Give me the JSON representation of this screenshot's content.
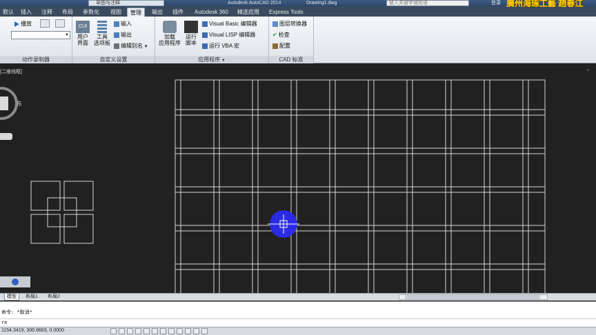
{
  "titlebar": {
    "workspace": "草图与注释",
    "app_title": "Autodesk AutoCAD 2014",
    "file_name": "Drawing1.dwg",
    "search_placeholder": "键入关键字或短语",
    "login": "登录",
    "watermark": "廣州海琢工藝 趙春江"
  },
  "ribbon_tabs": [
    "默认",
    "插入",
    "注释",
    "布局",
    "参数化",
    "视图",
    "管理",
    "输出",
    "插件",
    "Autodesk 360",
    "精选应用",
    "Express Tools"
  ],
  "active_tab": "管理",
  "panels": {
    "action_recorder": {
      "title": "动作录制器",
      "play_label": "播放"
    },
    "customization": {
      "title": "自定义设置",
      "cui_label": "用户\n界面",
      "cui_icon_text": "CUI",
      "tools_label": "工具\n选项板",
      "import_label": "输入",
      "export_label": "输出",
      "alias_label": "编辑别名"
    },
    "applications": {
      "title": "应用程序",
      "load_label": "加载\n应用程序",
      "run_script_label": "运行\n脚本",
      "vba_editor_label": "Visual Basic 编辑器",
      "lisp_editor_label": "Visual LISP 编辑器",
      "run_vba_label": "运行 VBA 宏"
    },
    "cad_standards": {
      "title": "CAD 标准",
      "layer_translator_label": "图层转换器",
      "check_label": "检查",
      "configure_label": "配置"
    }
  },
  "viewport": {
    "label": "[二维线框]",
    "viewcube_label": "东"
  },
  "layout_tabs": [
    "模型",
    "布局1",
    "布局2"
  ],
  "active_layout": "模型",
  "command": {
    "history_line": "命令: *取消*",
    "input_line": "re"
  },
  "status": {
    "coordinates": "1154.3419, 300.9683, 0.0000"
  }
}
